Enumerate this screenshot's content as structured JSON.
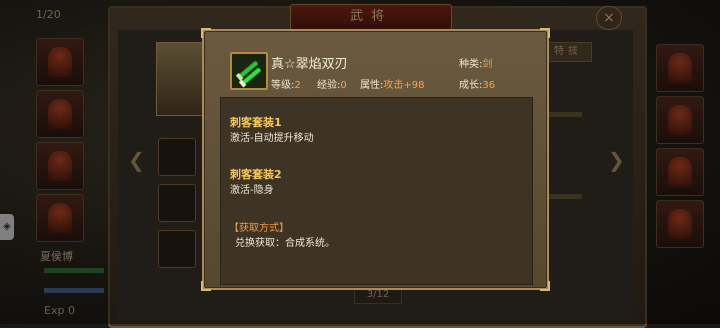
{
  "background": {
    "window_title": "武将",
    "counter": "1/20",
    "close_icon": "×",
    "skill_tab": "特技",
    "hero_name": "夏侯博",
    "exp_label": "Exp 0",
    "page_indicator": "3/12",
    "prev_icon": "❮",
    "next_icon": "❯"
  },
  "item": {
    "name": "真☆翠焰双刃",
    "type_label": "种类:",
    "type_value": "剑",
    "level_label": "等级:",
    "level_value": "2",
    "exp_label": "经验:",
    "exp_value": "0",
    "attr_label": "属性:",
    "attr_value": "攻击+98",
    "growth_label": "成长:",
    "growth_value": "36",
    "icon": "twin-jade-blades-icon",
    "icon_color": "#2fbf3a"
  },
  "sets": [
    {
      "title": "刺客套装1",
      "desc": "激活-自动提升移动"
    },
    {
      "title": "刺客套装2",
      "desc": "激活-隐身"
    }
  ],
  "source": {
    "title": "【获取方式】",
    "desc": "兑换获取：合成系统。"
  },
  "colors": {
    "gold_text": "#f4c85a",
    "orange_value": "#f2a44a",
    "popup_border": "#a88b58"
  }
}
